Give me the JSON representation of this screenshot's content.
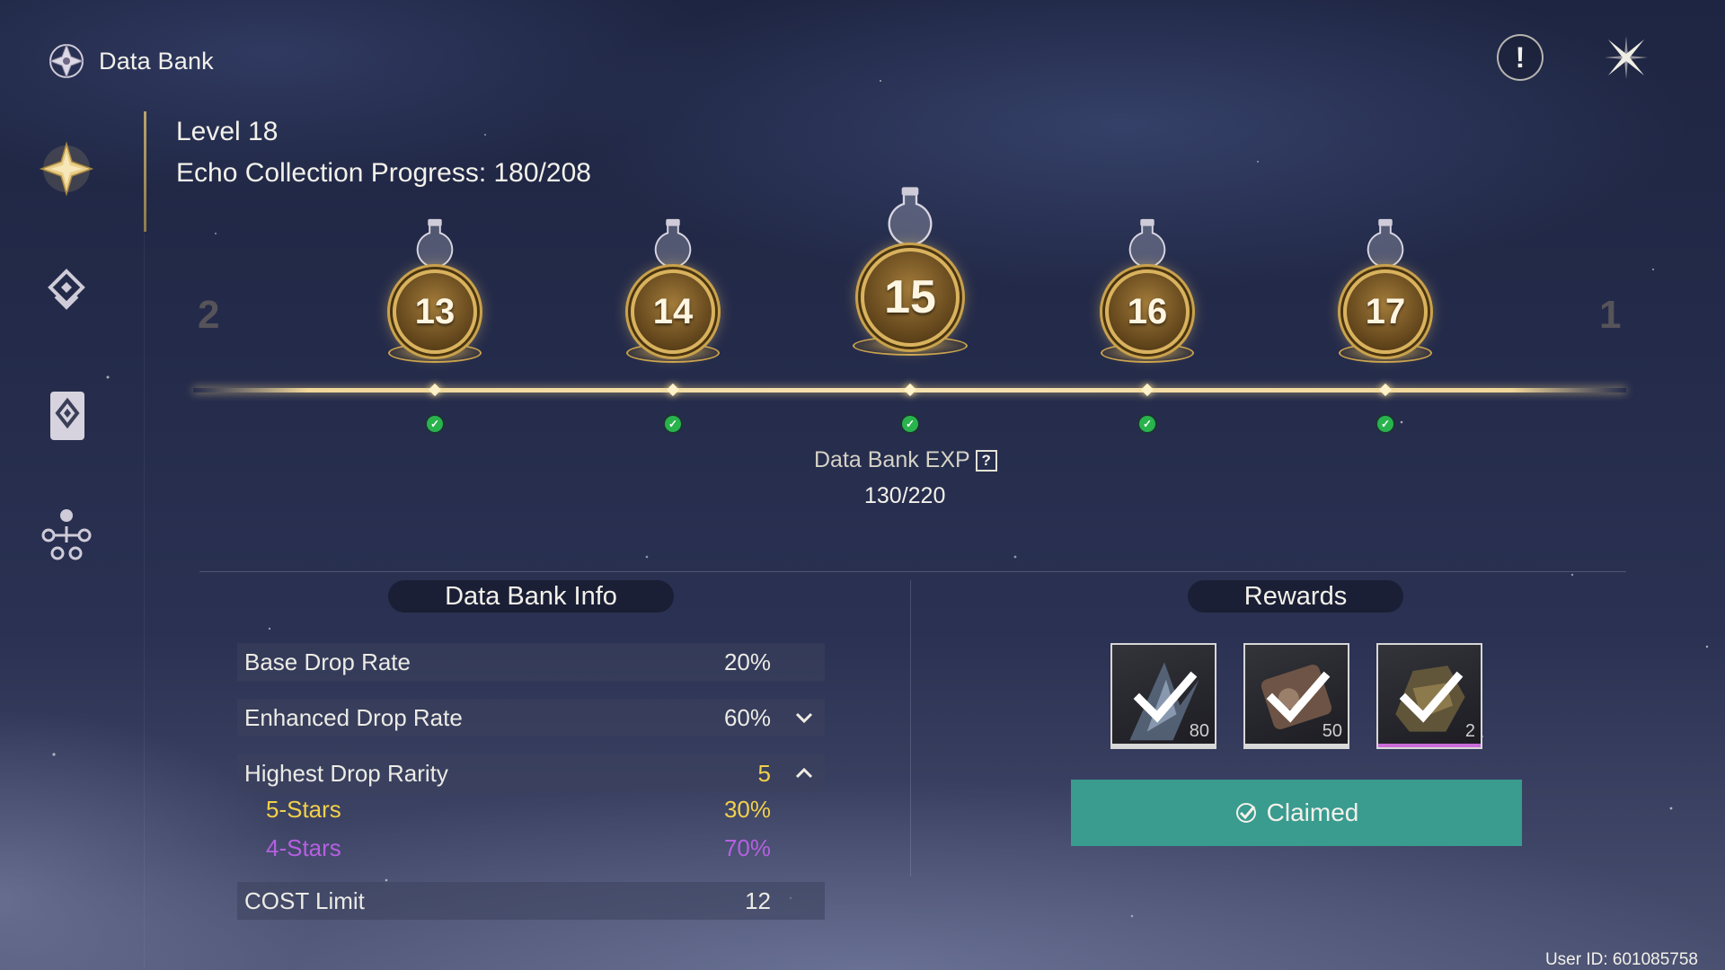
{
  "app": {
    "title": "Data Bank"
  },
  "header": {
    "level": "Level 18",
    "progress": "Echo Collection Progress: 180/208",
    "help_icon": "exclamation-icon",
    "close_icon": "close-icon"
  },
  "sidebar": {
    "items": [
      {
        "name": "data-bank",
        "icon": "star-crest-icon",
        "active": true
      },
      {
        "name": "echo-list",
        "icon": "stacked-diamond-icon",
        "active": false
      },
      {
        "name": "echo-card",
        "icon": "card-diamond-icon",
        "active": false
      },
      {
        "name": "sonata",
        "icon": "constellation-icon",
        "active": false
      }
    ]
  },
  "timeline": {
    "ghost_left": "2",
    "ghost_right": "1",
    "nodes": [
      {
        "level": "13",
        "claimed": true
      },
      {
        "level": "14",
        "claimed": true
      },
      {
        "level": "15",
        "claimed": true,
        "current": true
      },
      {
        "level": "16",
        "claimed": true
      },
      {
        "level": "17",
        "claimed": true
      }
    ],
    "exp_label": "Data Bank EXP",
    "exp_help": "?",
    "exp_value": "130/220"
  },
  "info": {
    "title": "Data Bank Info",
    "base_drop_label": "Base Drop Rate",
    "base_drop_value": "20%",
    "enhanced_drop_label": "Enhanced Drop Rate",
    "enhanced_drop_value": "60%",
    "rarity_label": "Highest Drop Rarity",
    "rarity_value": "5",
    "five_star_label": "5-Stars",
    "five_star_value": "30%",
    "four_star_label": "4-Stars",
    "four_star_value": "70%",
    "cost_label": "COST Limit",
    "cost_value": "12"
  },
  "rewards": {
    "title": "Rewards",
    "items": [
      {
        "count": "80",
        "bar_color": "#d9d9d9"
      },
      {
        "count": "50",
        "bar_color": "#d9d9d9"
      },
      {
        "count": "2",
        "bar_color": "#c96bd8"
      }
    ],
    "button_label": "Claimed"
  },
  "colors": {
    "five_star": "#f2d04a",
    "four_star": "#b560e0",
    "claimed_bg": "#3a9b8f",
    "gold": "#d9b25e"
  },
  "footer": {
    "user_id": "User ID: 601085758"
  }
}
